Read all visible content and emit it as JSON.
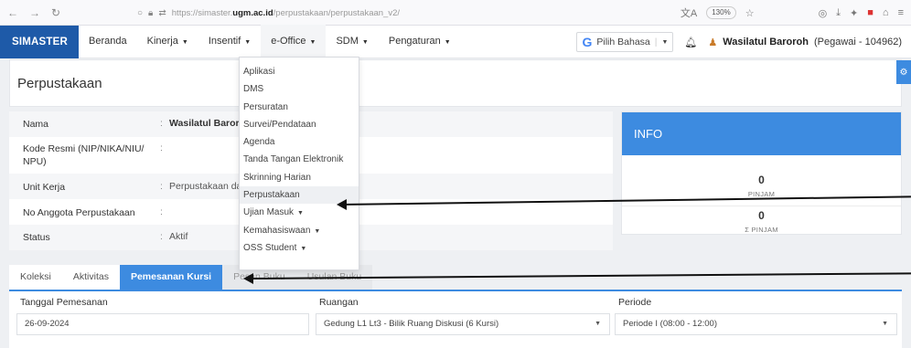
{
  "browser": {
    "url_prefix": "https://simaster.",
    "url_domain": "ugm.ac.id",
    "url_path": "/perpustakaan/perpustakaan_v2/",
    "zoom": "130%"
  },
  "nav": {
    "brand": "SIMASTER",
    "items": [
      {
        "label": "Beranda",
        "caret": false
      },
      {
        "label": "Kinerja",
        "caret": true
      },
      {
        "label": "Insentif",
        "caret": true
      },
      {
        "label": "e-Office",
        "caret": true
      },
      {
        "label": "SDM",
        "caret": true
      },
      {
        "label": "Pengaturan",
        "caret": true
      }
    ],
    "lang_label": "Pilih Bahasa",
    "lang_caret": "▼",
    "user_name": "Wasilatul Baroroh",
    "user_role": "(Pegawai - 104962)"
  },
  "page": {
    "title": "Perpustakaan"
  },
  "profile": {
    "rows": [
      {
        "label": "Nama",
        "value": "Wasilatul Baroroh"
      },
      {
        "label": "Kode Resmi (NIP/NIKA/NIU/ NPU)",
        "value": ""
      },
      {
        "label": "Unit Kerja",
        "value": "Perpustakaan dan Ars"
      },
      {
        "label": "No Anggota Perpustakaan",
        "value": ""
      },
      {
        "label": "Status",
        "value": "Aktif"
      }
    ]
  },
  "info": {
    "title": "INFO",
    "pinjam_value": "0",
    "pinjam_label": "PINJAM",
    "total_value": "0",
    "total_label": "Σ PINJAM"
  },
  "dropdown": {
    "items": [
      {
        "label": "Aplikasi",
        "caret": false
      },
      {
        "label": "DMS",
        "caret": false
      },
      {
        "label": "Persuratan",
        "caret": false
      },
      {
        "label": "Survei/Pendataan",
        "caret": false
      },
      {
        "label": "Agenda",
        "caret": false
      },
      {
        "label": "Tanda Tangan Elektronik",
        "caret": false
      },
      {
        "label": "Skrinning Harian",
        "caret": false
      },
      {
        "label": "Perpustakaan",
        "caret": false
      },
      {
        "label": "Ujian Masuk",
        "caret": true
      },
      {
        "label": "Kemahasiswaan",
        "caret": true
      },
      {
        "label": "OSS Student",
        "caret": true
      }
    ],
    "hover_index": 7
  },
  "tabs": [
    {
      "label": "Koleksi",
      "state": "normal"
    },
    {
      "label": "Aktivitas",
      "state": "normal"
    },
    {
      "label": "Pemesanan Kursi",
      "state": "active"
    },
    {
      "label": "Pesan Buku",
      "state": "dim"
    },
    {
      "label": "Usulan Buku",
      "state": "dim"
    }
  ],
  "form": {
    "tanggal_label": "Tanggal Pemesanan",
    "tanggal_value": "26-09-2024",
    "ruangan_label": "Ruangan",
    "ruangan_value": "Gedung L1 Lt3 - Bilik Ruang Diskusi (6 Kursi)",
    "periode_label": "Periode",
    "periode_value": "Periode I (08:00 - 12:00)"
  },
  "colors": {
    "brand": "#1e5aa8",
    "accent": "#3d8be0"
  }
}
